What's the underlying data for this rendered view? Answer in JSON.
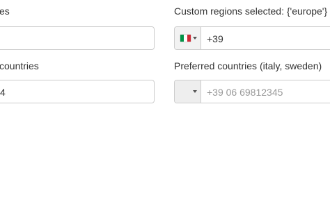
{
  "left_column": {
    "label_1": "es",
    "input_1_value": "",
    "label_2": "countries",
    "input_2_value": "4"
  },
  "right_column": {
    "label_1": "Custom regions selected: {'europe'}",
    "phone_1": {
      "flag_icon": "italy-flag-icon",
      "value": "+39"
    },
    "label_2": "Preferred countries (italy, sweden)",
    "phone_2": {
      "placeholder": "+39 06 69812345"
    }
  },
  "colors": {
    "flag_italy": [
      "#009246",
      "#ffffff",
      "#ce2b37"
    ],
    "border": "#cccccc",
    "placeholder": "#999999"
  }
}
